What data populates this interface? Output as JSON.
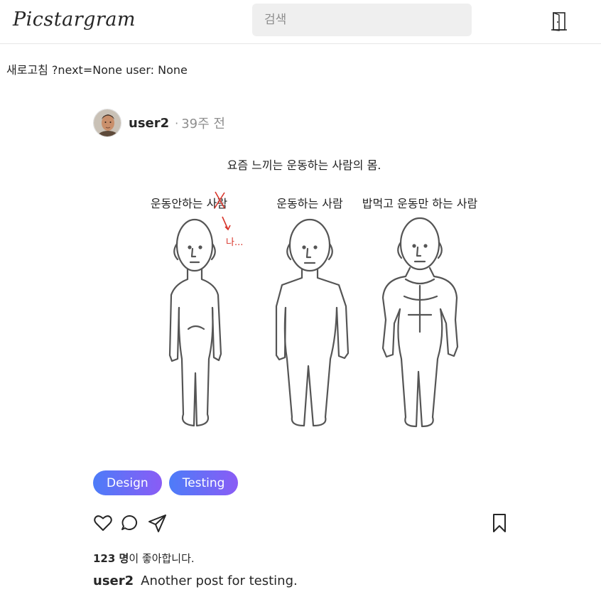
{
  "header": {
    "logo": "Picstargram",
    "search_placeholder": "검색",
    "logout_icon": "door-icon"
  },
  "debug": {
    "refresh": "새로고침",
    "info": "?next=None user: None"
  },
  "post": {
    "username": "user2",
    "separator": "·",
    "time_ago": "39주 전",
    "image": {
      "title": "요즘 느끼는 운동하는 사람의 몸.",
      "labels": [
        "운동안하는 사람",
        "운동하는 사람",
        "밥먹고 운동만 하는 사람"
      ],
      "scribble": "나..."
    },
    "tags": [
      "Design",
      "Testing"
    ],
    "likes_count": "123 명",
    "likes_suffix": "이 좋아합니다.",
    "caption_user": "user2",
    "caption_text": "Another post for testing."
  }
}
